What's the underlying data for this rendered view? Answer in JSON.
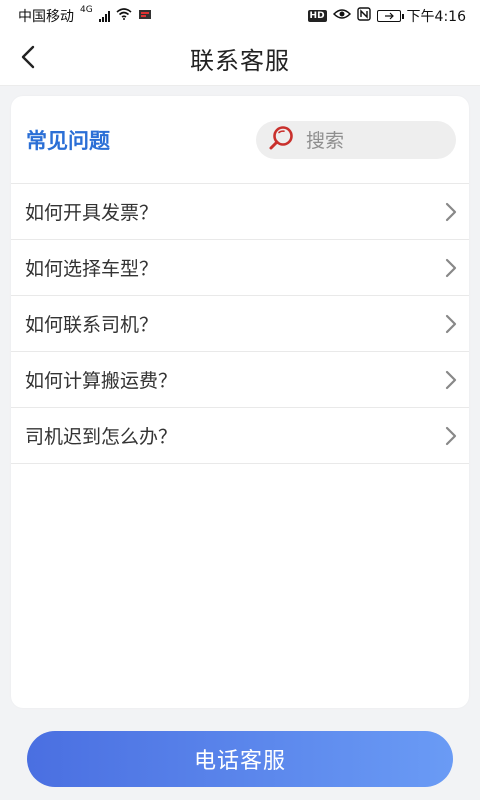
{
  "status_bar": {
    "carrier": "中国移动",
    "network": "4G",
    "time": "下午4:16",
    "hd": "HD",
    "nfc": "N"
  },
  "nav": {
    "title": "联系客服"
  },
  "faq": {
    "heading": "常见问题",
    "search_placeholder": "搜索",
    "items": [
      {
        "label": "如何开具发票？"
      },
      {
        "label": "如何选择车型？"
      },
      {
        "label": "如何联系司机？"
      },
      {
        "label": "如何计算搬运费？"
      },
      {
        "label": "司机迟到怎么办？"
      }
    ]
  },
  "bottom": {
    "call_label": "电话客服"
  },
  "colors": {
    "accent_blue": "#2b6fd6",
    "button_gradient_start": "#4a6fe1",
    "button_gradient_end": "#6a9bf5",
    "search_icon_red": "#c9302c"
  },
  "icons": {
    "back": "chevron-left-icon",
    "search": "search-icon",
    "row_arrow": "chevron-right-icon"
  }
}
